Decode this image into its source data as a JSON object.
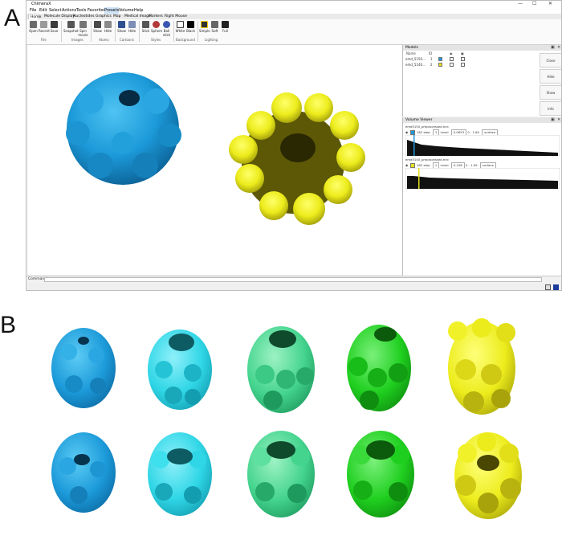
{
  "panel_labels": {
    "a": "A",
    "b": "B"
  },
  "window": {
    "title": "ChimeraX",
    "controls": {
      "minimize": "—",
      "maximize": "☐",
      "close": "✕"
    }
  },
  "menu": [
    "File",
    "Edit",
    "Select",
    "Actions",
    "Tools",
    "Favorites",
    "Presets",
    "Volume",
    "Help"
  ],
  "menu_active": "Presets",
  "ribbon_tabs": [
    "Home",
    "Molecule Display",
    "Nucleotides",
    "Graphics",
    "Map",
    "Medical Image",
    "Markers",
    "Right Mouse"
  ],
  "ribbon": {
    "file_buttons": [
      "Open",
      "Recent",
      "Save"
    ],
    "images_buttons": [
      "Snapshot",
      "Spin movie"
    ],
    "atoms_buttons": [
      "Show",
      "Hide"
    ],
    "cartoons_buttons": [
      "Show",
      "Hide"
    ],
    "styles_buttons": [
      "Stick",
      "Sphere",
      "Ball stick"
    ],
    "background_buttons": [
      "White",
      "Black"
    ],
    "lighting_buttons": [
      "Simple",
      "Soft",
      "Full"
    ],
    "groups": [
      "File",
      "Images",
      "Atoms",
      "Cartoons",
      "Styles",
      "Background",
      "Lighting"
    ]
  },
  "models_panel": {
    "title": "Models",
    "columns": [
      "Name",
      "ID",
      "",
      "◉",
      "▣"
    ],
    "rows": [
      {
        "name": "emd_5150...",
        "id": "1",
        "color": "#ffd400"
      },
      {
        "name": "emd_5140...",
        "id": "2",
        "color": "#ffd400"
      }
    ],
    "side_buttons": [
      "Close",
      "Hide",
      "Show",
      "Info"
    ]
  },
  "volume_viewer": {
    "title": "Volume Viewer",
    "volumes": [
      {
        "name": "emd5150_preprocessed.mrc",
        "size": "182",
        "step": "1",
        "level": "0.0653",
        "range": "0 - 1.84",
        "style": "surface",
        "color": "#1d98d6"
      },
      {
        "name": "emd5140_preprocessed.mrc",
        "size": "182",
        "step": "1",
        "level": "0.108",
        "range": "0 - 1.99",
        "style": "surface",
        "color": "#e6e01a"
      }
    ],
    "labels": {
      "step": "step",
      "level": "Level"
    }
  },
  "command_line": {
    "label": "Command:",
    "value": ""
  },
  "colors": {
    "blue": "#1c9ad9",
    "blue_dark": "#0e6fa8",
    "cyan": "#2fd6e6",
    "cyan_dark": "#139db0",
    "seafoam": "#44d48e",
    "seafoam_dark": "#1e9a5e",
    "green": "#1fcf1f",
    "green_dark": "#0f8d0f",
    "yellow": "#ecec1c",
    "yellow_dark": "#a8a30a",
    "accent_select": "#cfe3f7"
  }
}
